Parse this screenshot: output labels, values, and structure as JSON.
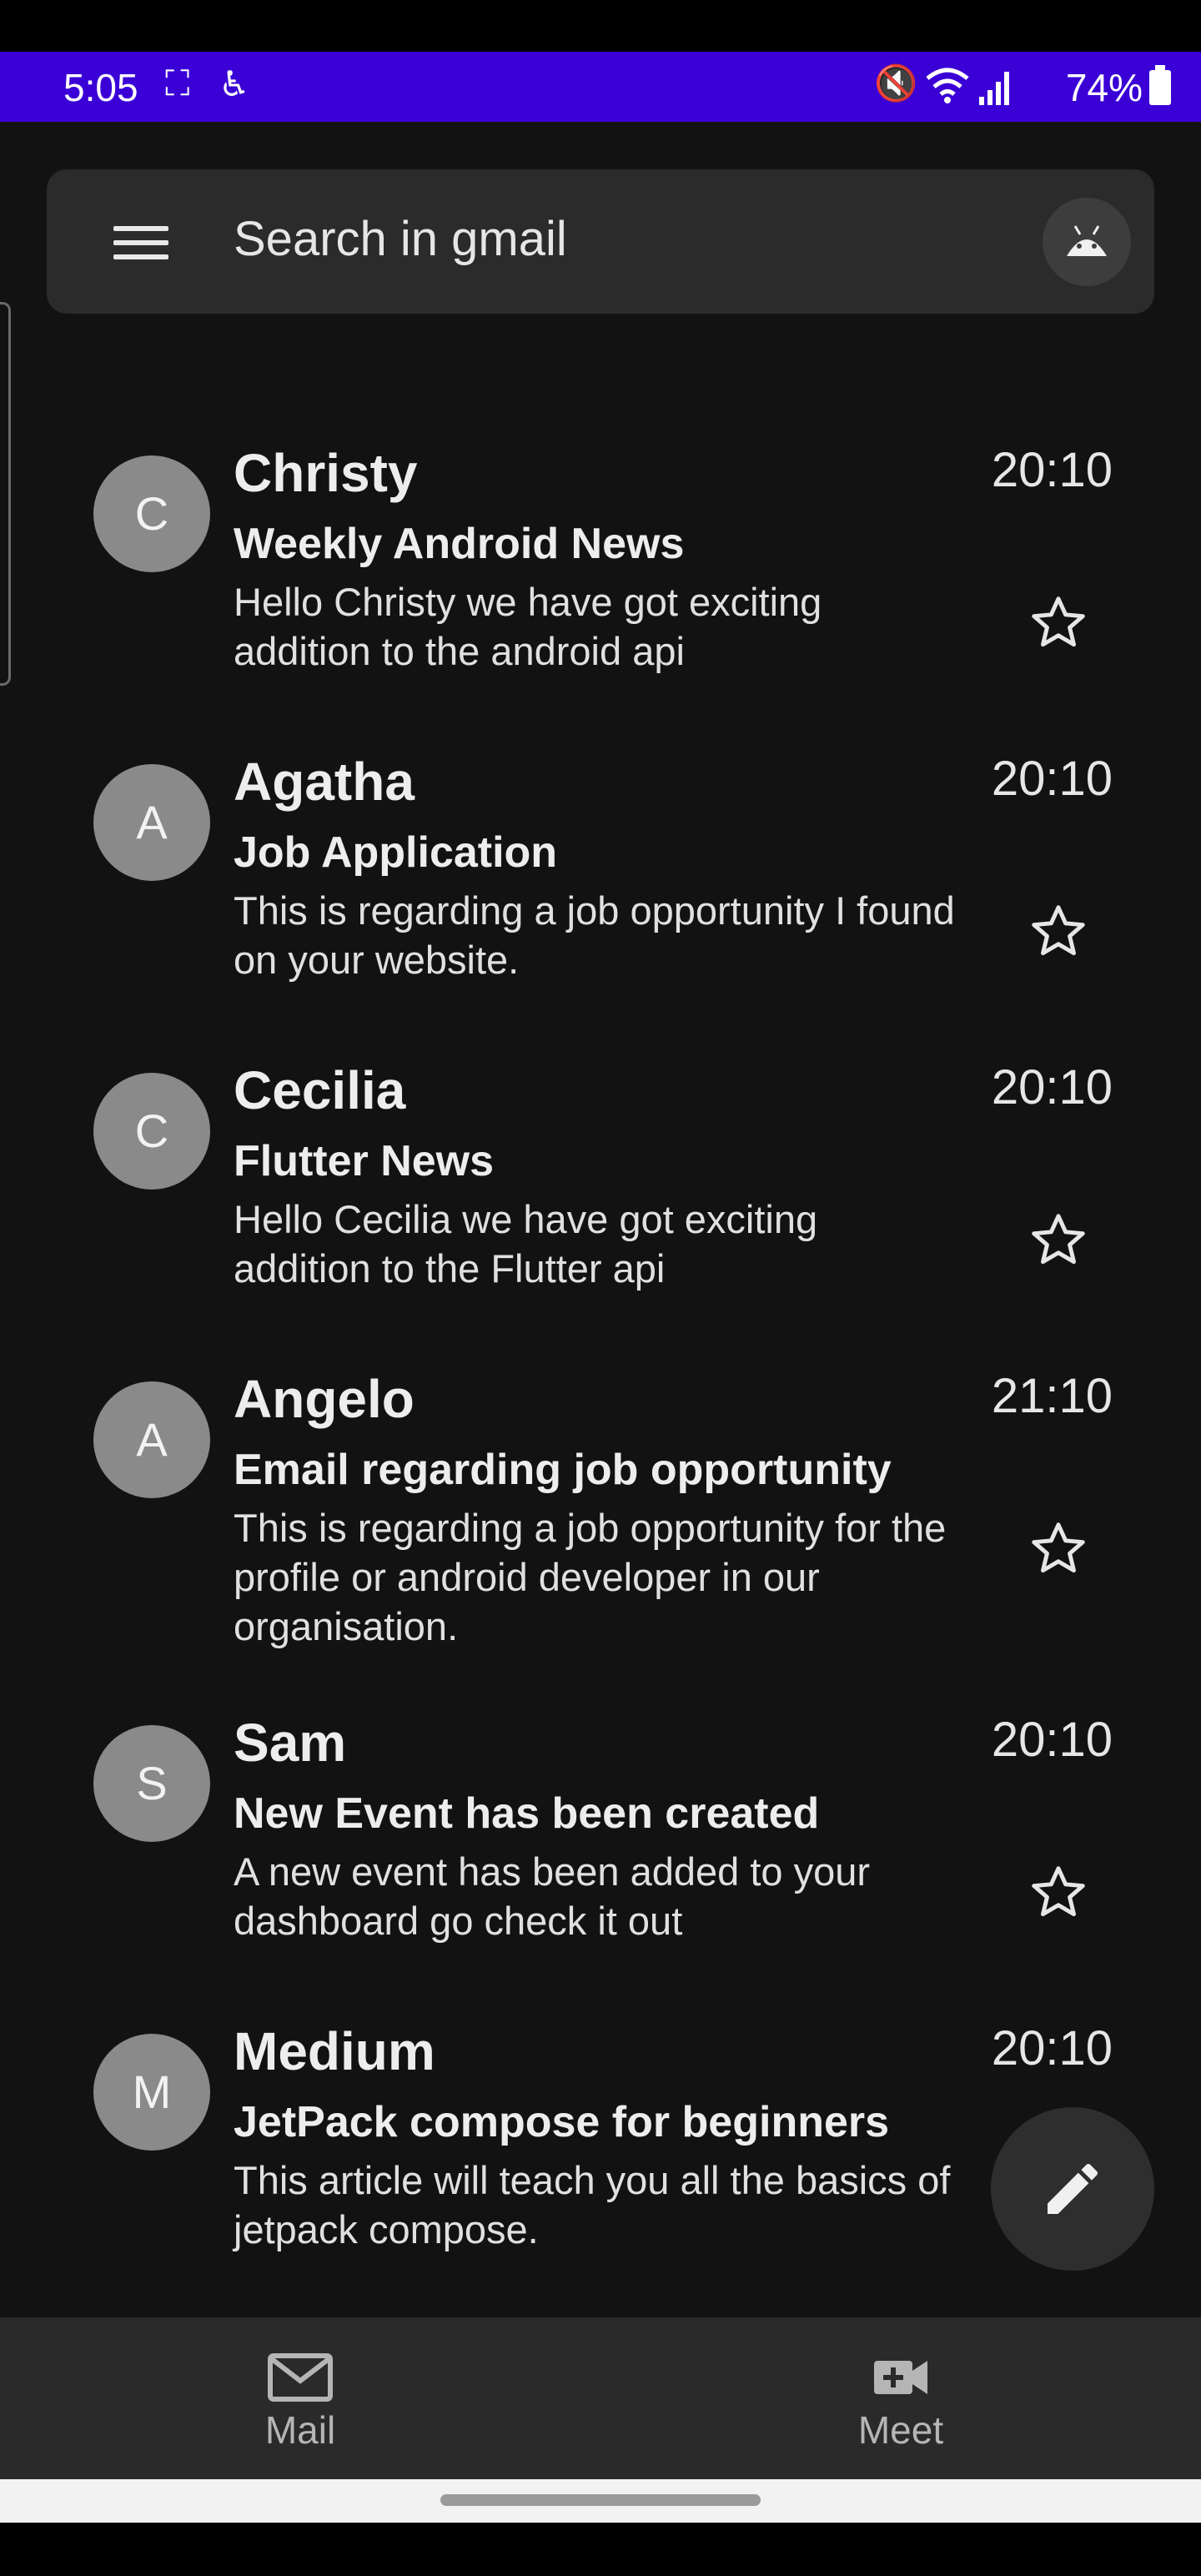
{
  "status_bar": {
    "time": "5:05",
    "battery": "74%",
    "icons": [
      "screenshot-frame-icon",
      "accessibility-icon",
      "mute-icon",
      "wifi-icon",
      "signal-icon",
      "battery-icon"
    ]
  },
  "search": {
    "placeholder": "Search in gmail",
    "menu_icon": "hamburger-menu-icon",
    "account_icon": "android-icon"
  },
  "emails": [
    {
      "initial": "C",
      "sender": "Christy",
      "subject": "Weekly Android News",
      "preview": "Hello Christy we have got exciting addition  to the android api",
      "time": "20:10",
      "starred": false
    },
    {
      "initial": "A",
      "sender": "Agatha",
      "subject": "Job Application",
      "preview": "This is regarding a job opportunity I found on your website.",
      "time": "20:10",
      "starred": false
    },
    {
      "initial": "C",
      "sender": "Cecilia",
      "subject": "Flutter News",
      "preview": "Hello Cecilia we have got exciting addition  to the Flutter api",
      "time": "20:10",
      "starred": false
    },
    {
      "initial": "A",
      "sender": "Angelo",
      "subject": "Email regarding job opportunity",
      "preview": "This is regarding a job opportunity for the profile or android developer in our organisation.",
      "time": "21:10",
      "starred": false
    },
    {
      "initial": "S",
      "sender": "Sam",
      "subject": "New Event has been created",
      "preview": "A new event has been added to your dashboard go check it out",
      "time": "20:10",
      "starred": false
    },
    {
      "initial": "M",
      "sender": "Medium",
      "subject": "JetPack compose for beginners",
      "preview": "This article will teach you all the basics of jetpack compose.",
      "time": "20:10",
      "starred": false
    }
  ],
  "fab": {
    "icon": "pencil-compose-icon"
  },
  "bottom_nav": {
    "mail_label": "Mail",
    "meet_label": "Meet"
  },
  "colors": {
    "status_bar": "#3a00d6",
    "background": "#121212",
    "surface": "#2b2b2b",
    "avatar": "#8a8a8a"
  }
}
